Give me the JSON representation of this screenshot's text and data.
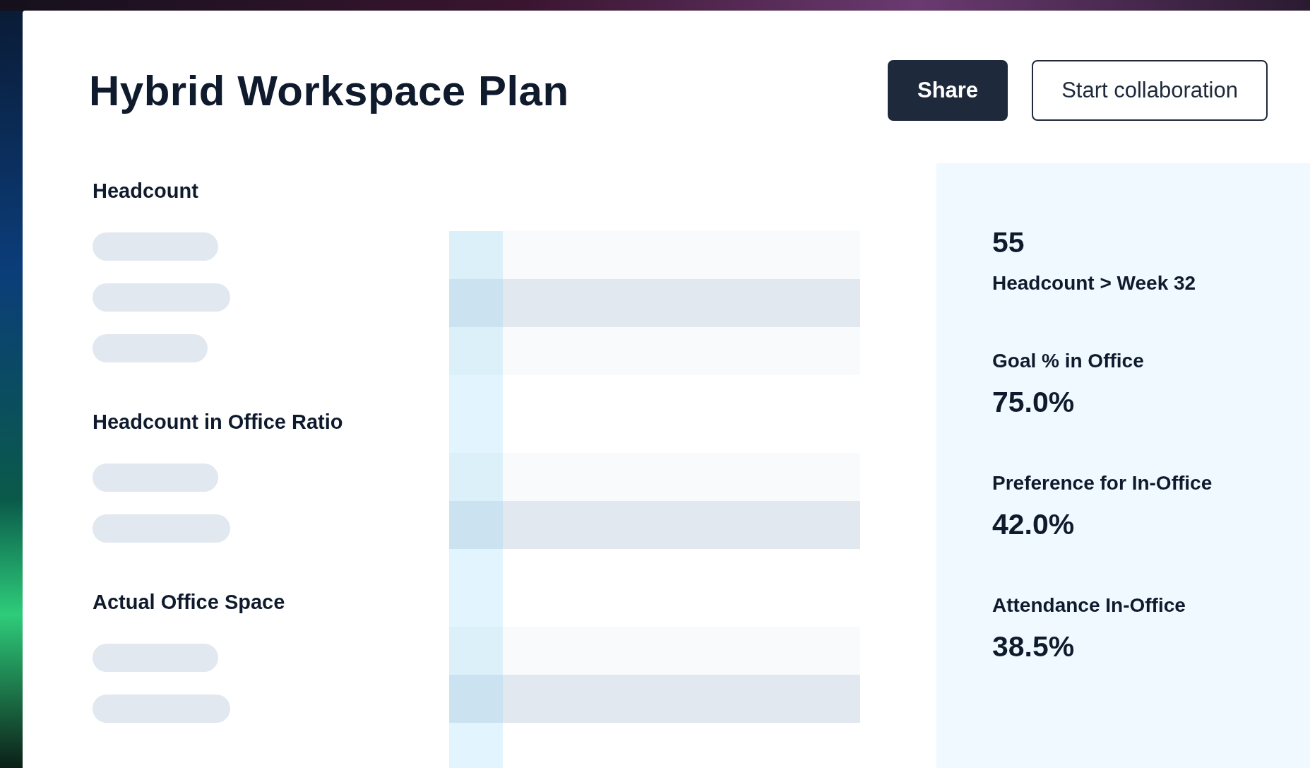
{
  "title": "Hybrid Workspace Plan",
  "actions": [
    {
      "label": "Share",
      "kind": "primary"
    },
    {
      "label": "Start collaboration",
      "kind": "outline"
    }
  ],
  "sections": [
    {
      "title": "Headcount",
      "skeleton_lines": [
        {
          "kind": "medium"
        },
        {
          "kind": "long"
        },
        {
          "kind": "short"
        }
      ]
    },
    {
      "title": "Headcount in Office Ratio",
      "skeleton_lines": [
        {
          "kind": "medium"
        },
        {
          "kind": "long"
        }
      ]
    },
    {
      "title": "Actual Office Space",
      "skeleton_lines": [
        {
          "kind": "medium"
        },
        {
          "kind": "long"
        }
      ]
    }
  ],
  "skeleton_rows": [
    {
      "kind": "light"
    },
    {
      "kind": "dark"
    },
    {
      "kind": "light"
    },
    {
      "kind": "blank"
    },
    {
      "kind": "light"
    },
    {
      "kind": "dark"
    },
    {
      "kind": "blank"
    },
    {
      "kind": "light"
    },
    {
      "kind": "dark"
    },
    {
      "kind": "blank"
    }
  ],
  "stats": [
    {
      "kind": "value_first",
      "value": "55",
      "label": "Headcount > Week 32"
    },
    {
      "kind": "label_first",
      "label": "Goal % in Office",
      "value": "75.0%"
    },
    {
      "kind": "label_first",
      "label": "Preference for In-Office",
      "value": "42.0%"
    },
    {
      "kind": "label_first",
      "label": "Attendance In-Office",
      "value": "38.5%"
    }
  ]
}
